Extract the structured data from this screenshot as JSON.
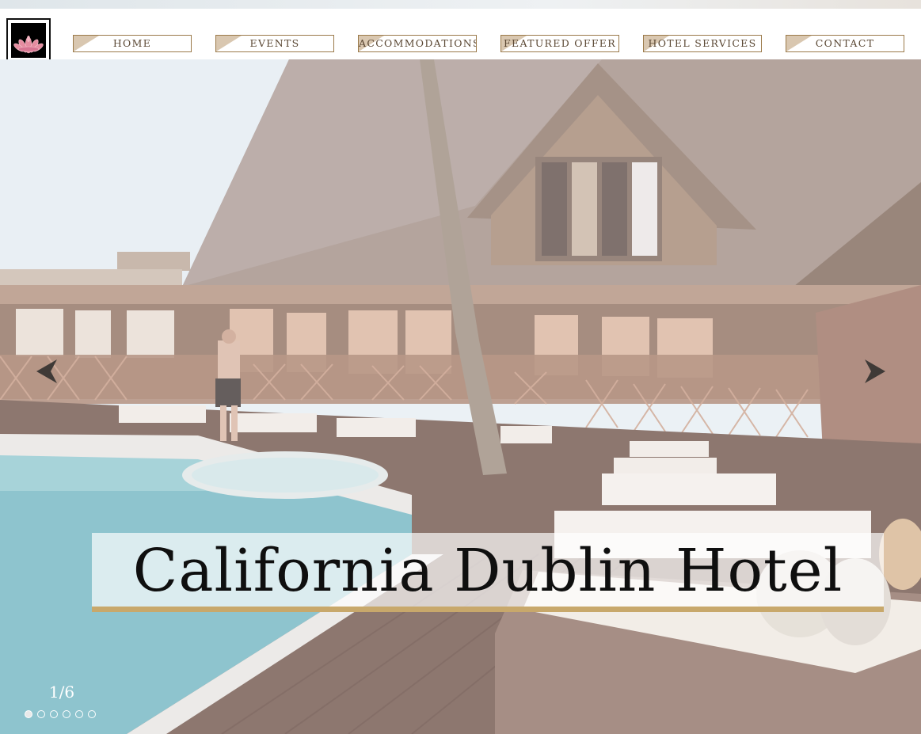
{
  "nav": {
    "logo_icon": "lotus-flower-icon",
    "items": [
      {
        "label": "HOME"
      },
      {
        "label": "EVENTS"
      },
      {
        "label": "ACCOMMODATIONS"
      },
      {
        "label": "FEATURED OFFER"
      },
      {
        "label": "HOTEL SERVICES"
      },
      {
        "label": "CONTACT"
      }
    ]
  },
  "hero": {
    "caption": "California Dublin Hotel",
    "counter": "1/6",
    "current_slide": 1,
    "total_slides": 6,
    "prev_icon": "chevron-left-icon",
    "next_icon": "chevron-right-icon"
  },
  "colors": {
    "accent_gold": "#c8a86b",
    "nav_border": "#9b7a4a",
    "nav_corner": "#d9c7b0"
  }
}
